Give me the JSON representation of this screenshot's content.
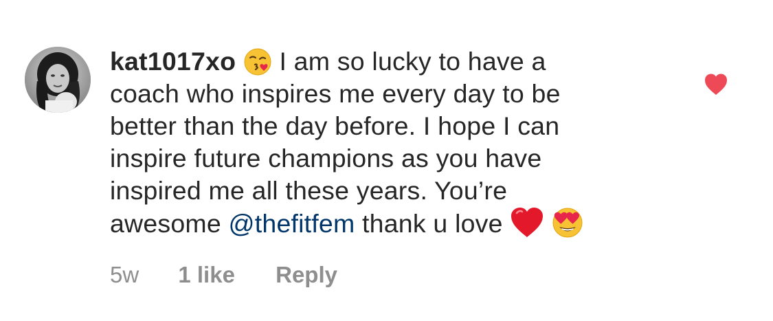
{
  "comment": {
    "username": "kat1017xo",
    "emoji_kiss": "face-blowing-a-kiss-icon",
    "lines": [
      "I am so lucky to have a",
      "coach who inspires me every day to be",
      "better than the day before. I hope I can",
      "inspire future champions as you have",
      "inspired me all these years. You’re"
    ],
    "last_line_prefix": "awesome",
    "mention": "@thefitfem",
    "last_line_suffix": "thank u love",
    "emoji_heart": "red-heart-icon",
    "emoji_heart_eyes": "heart-eyes-icon"
  },
  "meta": {
    "time": "5w",
    "likes": "1 like",
    "reply": "Reply"
  },
  "colors": {
    "text": "#262626",
    "mention": "#003569",
    "meta": "#8e8e8e",
    "like_heart": "#ed4956"
  }
}
